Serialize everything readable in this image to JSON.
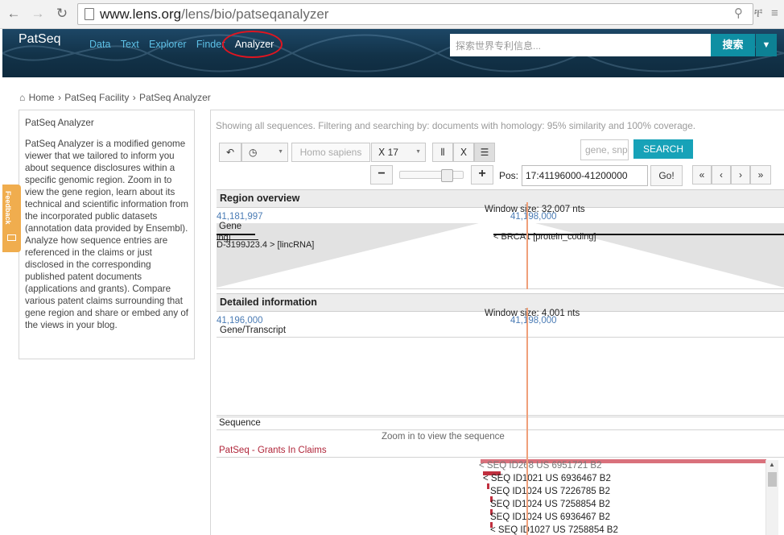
{
  "browser": {
    "url_domain": "www.lens.org",
    "url_path": "/lens/bio/patseqanalyzer"
  },
  "header": {
    "brand": "PatSeq",
    "nav": [
      "Data",
      "Text",
      "Explorer",
      "Finder",
      "Analyzer"
    ],
    "search_placeholder": "探索世界专利信息...",
    "search_button": "搜索"
  },
  "breadcrumb": {
    "home": "Home",
    "sep": "›",
    "facility": "PatSeq Facility",
    "current": "PatSeq Analyzer"
  },
  "sidebar": {
    "title": "PatSeq Analyzer",
    "body": "PatSeq Analyzer is a modified genome viewer that we tailored to inform you about sequence disclosures within a specific genomic region. Zoom in to view the gene region, learn about its technical and scientific information from the incorporated public datasets (annotation data provided by Ensembl). Analyze how sequence entries are referenced in the claims or just disclosed in the corresponding published patent documents (applications and grants). Compare various patent claims surrounding that gene region and share or embed any of the views in your blog."
  },
  "feedback_label": "Feedback",
  "analyzer": {
    "status": "Showing all sequences. Filtering and searching by: documents with homology: 95% similarity and 100% coverage.",
    "species": "Homo sapiens",
    "chromosome": "17",
    "gene_placeholder": "gene, snp",
    "search_button": "SEARCH",
    "pos_label": "Pos:",
    "position": "17:41196000-41200000",
    "go_button": "Go!",
    "region_overview": {
      "title": "Region overview",
      "window": "Window size: 32,007 nts",
      "start": "41,181,997",
      "center": "41,198,000",
      "gene_label": "Gene",
      "left_gene_fragment": "ing]",
      "left_gene": "D-3199J23.4 > [lincRNA]",
      "brca_gene": "< BRCA1 [protein_coding]"
    },
    "detailed": {
      "title": "Detailed information",
      "window": "Window size: 4,001 nts",
      "start": "41,196,000",
      "center": "41,198,000",
      "gene_transcript": "Gene/Transcript"
    },
    "sequence": {
      "label": "Sequence",
      "zoom_msg": "Zoom in to view the sequence",
      "track_title": "PatSeq - Grants In Claims",
      "entries": [
        "< SEQ ID268 US 6951721 B2",
        "< SEQ ID1021 US 6936467 B2",
        "SEQ ID1024 US 7226785 B2",
        "SEQ ID1024 US 7258854 B2",
        "SEQ ID1024 US 6936467 B2",
        "< SEQ ID1027 US 7258854 B2"
      ]
    }
  },
  "colors": {
    "header_bg": "#123248",
    "nav_link": "#5dc0e6",
    "search_btn": "#0f8fa3",
    "highlight_circle": "#e01520",
    "feedback": "#f0ad4e",
    "position_line": "#f0a07a",
    "track_title": "#b0263a",
    "coord_blue": "#4b7cb5"
  }
}
